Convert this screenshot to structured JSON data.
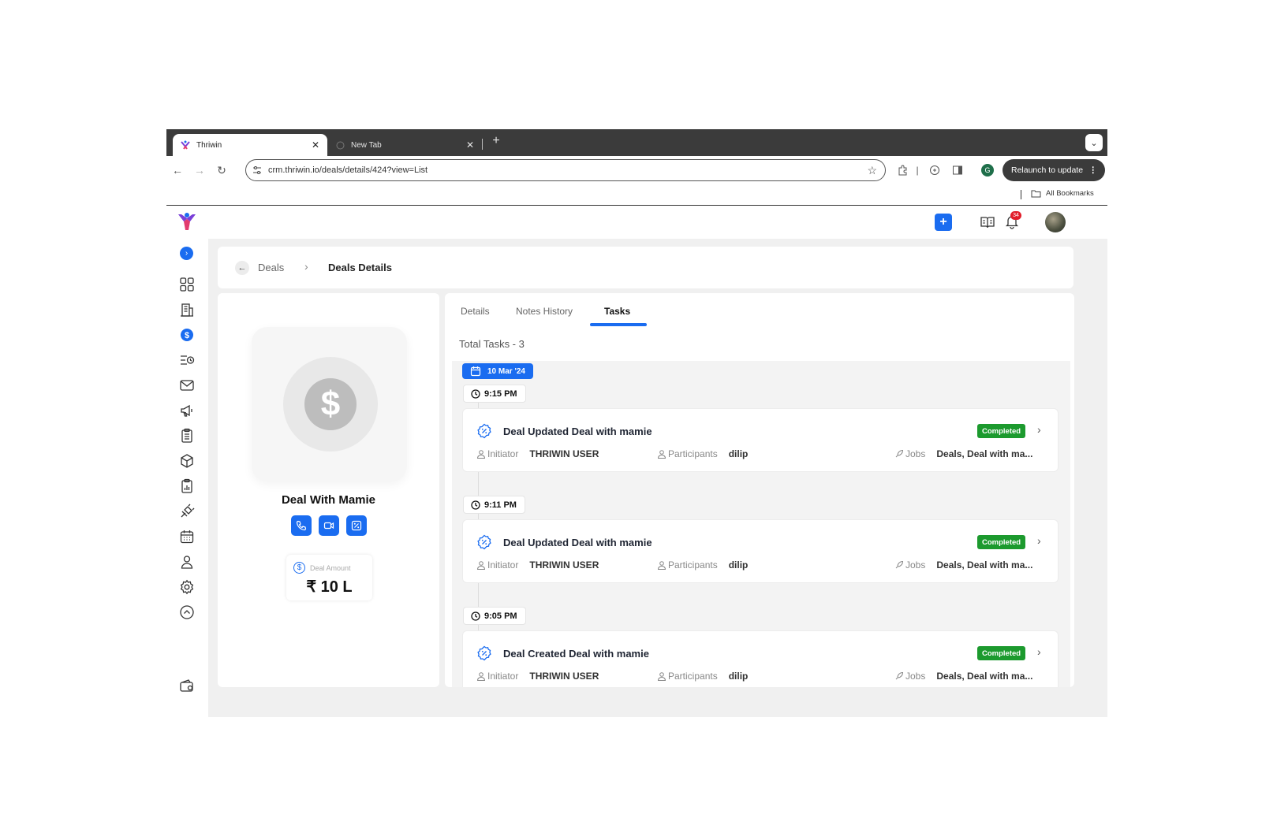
{
  "browser": {
    "active_tab": "Thriwin",
    "inactive_tab": "New Tab",
    "url": "crm.thriwin.io/deals/details/424?view=List",
    "relaunch_label": "Relaunch to update",
    "profile_initial": "G",
    "bookmarks_label": "All Bookmarks"
  },
  "topbar": {
    "notification_count": "34"
  },
  "breadcrumb": {
    "parent": "Deals",
    "current": "Deals Details"
  },
  "deal": {
    "name": "Deal With Mamie",
    "amount_label": "Deal Amount",
    "amount_value": "₹ 10 L"
  },
  "tabs": [
    {
      "label": "Details",
      "active": false
    },
    {
      "label": "Notes History",
      "active": false
    },
    {
      "label": "Tasks",
      "active": true
    }
  ],
  "total_tasks": "Total Tasks - 3",
  "date_group": "10 Mar '24",
  "meta_labels": {
    "initiator": "Initiator",
    "participants": "Participants",
    "jobs": "Jobs"
  },
  "tasks": [
    {
      "time": "9:15 PM",
      "title": "Deal Updated Deal with mamie",
      "status": "Completed",
      "initiator": "THRIWIN USER",
      "participants": "dilip",
      "jobs": "Deals, Deal with ma..."
    },
    {
      "time": "9:11 PM",
      "title": "Deal Updated Deal with mamie",
      "status": "Completed",
      "initiator": "THRIWIN USER",
      "participants": "dilip",
      "jobs": "Deals, Deal with ma..."
    },
    {
      "time": "9:05 PM",
      "title": "Deal Created Deal with mamie",
      "status": "Completed",
      "initiator": "THRIWIN USER",
      "participants": "dilip",
      "jobs": "Deals, Deal with ma..."
    }
  ],
  "colors": {
    "accent": "#1a6cf0",
    "status_completed": "#1c9a2e",
    "badge": "#e11d2a"
  },
  "icons": {
    "sidebar": [
      "dashboard-icon",
      "building-icon",
      "deals-icon",
      "activity-icon",
      "mail-icon",
      "campaign-icon",
      "checklist-icon",
      "product-icon",
      "report-icon",
      "integration-icon",
      "calendar-icon",
      "user-icon",
      "settings-icon",
      "collapse-icon",
      "wallet-icon"
    ]
  }
}
